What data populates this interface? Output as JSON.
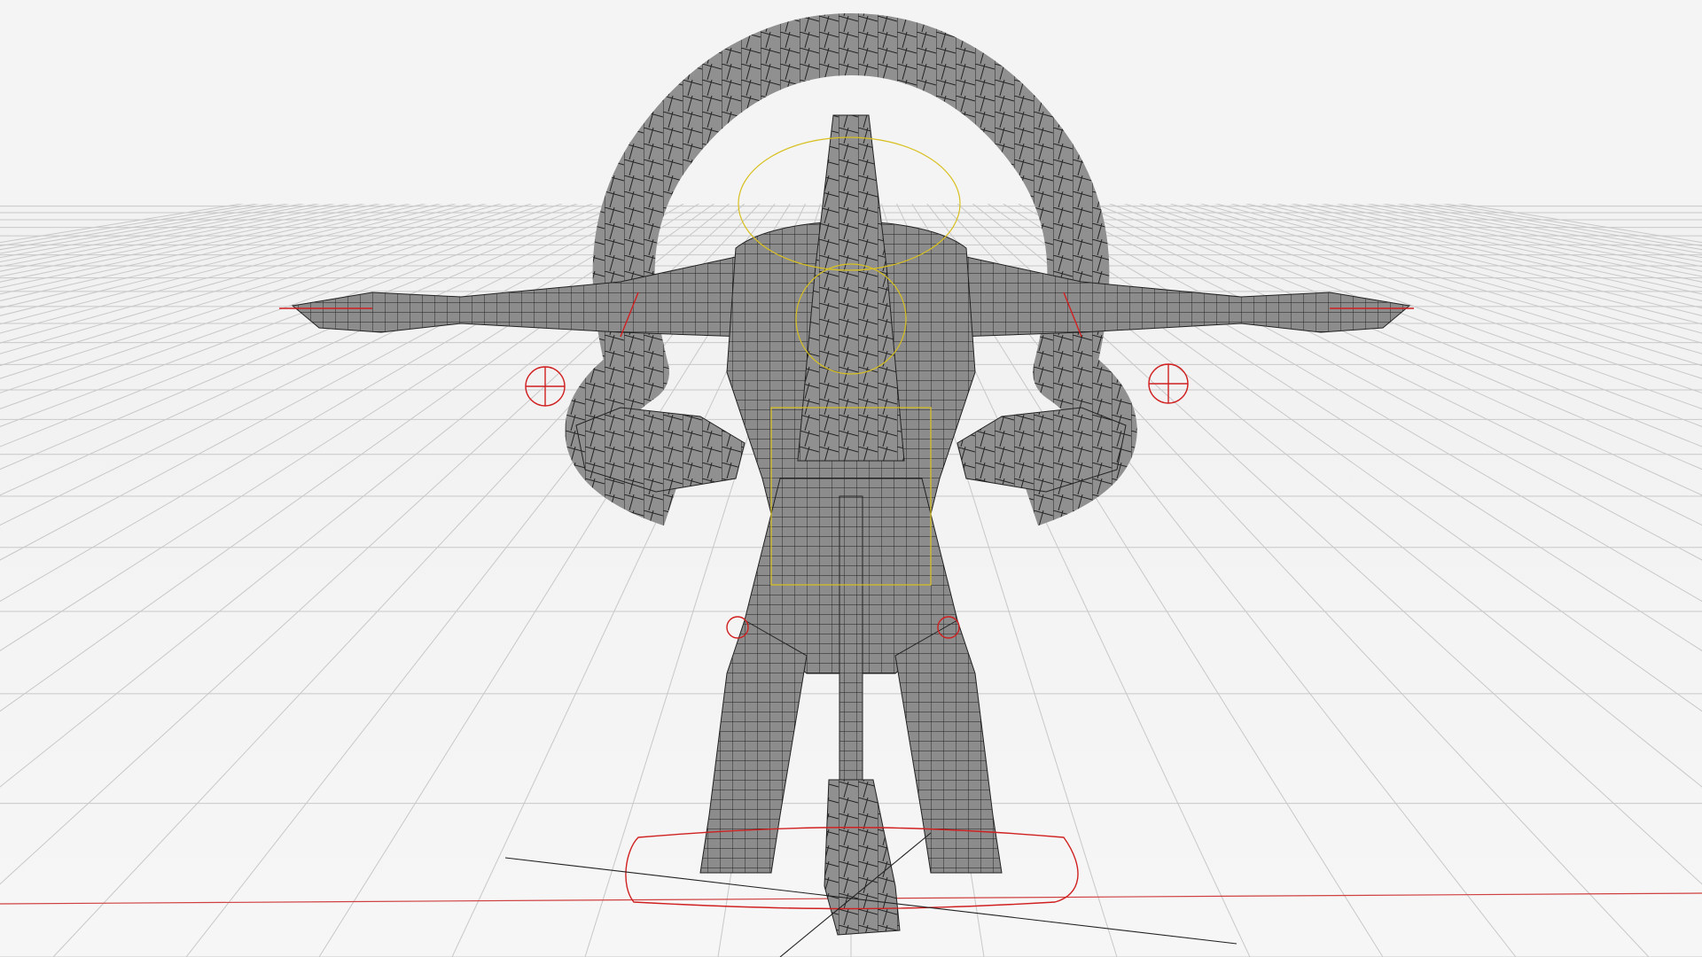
{
  "viewport": {
    "background_color": "#f4f4f4",
    "grid_color": "#c8c8c8",
    "x_axis_color": "#d04040",
    "mesh_color": "#8c8c8c",
    "wire_color": "#1e1e1e",
    "rig_color": "#d02020",
    "bone_color": "#d8c020"
  }
}
